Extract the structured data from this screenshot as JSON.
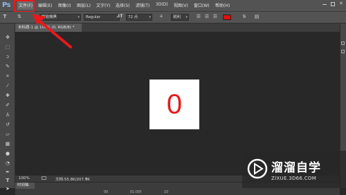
{
  "app": {
    "logo": "Ps"
  },
  "menu": {
    "items": [
      "文件(F)",
      "编辑(E)",
      "图像(I)",
      "图层(L)",
      "文字(Y)",
      "选择(S)",
      "滤镜(T)",
      "3D(D)",
      "视图(V)",
      "窗口(W)",
      "帮助(H)"
    ]
  },
  "options": {
    "font_family": "微软雅黑",
    "font_style": "Regular",
    "font_size": "72 点",
    "aa_label": "a",
    "aa_mode": "锐利",
    "color": "#e01010"
  },
  "document": {
    "tab_label": "未标题-1 @ 100% (0, RGB/8) *",
    "canvas_text": "0",
    "canvas_text_color": "#e8191b"
  },
  "status": {
    "zoom": "100%",
    "doc_info": "文档:55.8K/207.9K"
  },
  "timeline": {
    "tab_label": "时间轴",
    "marks": [
      "00",
      "01:00f",
      "10"
    ]
  },
  "watermark": {
    "title": "溜溜自学",
    "url": "ZIXUE.3D66.COM"
  },
  "annotation": {
    "highlight_color": "#e8191b"
  }
}
